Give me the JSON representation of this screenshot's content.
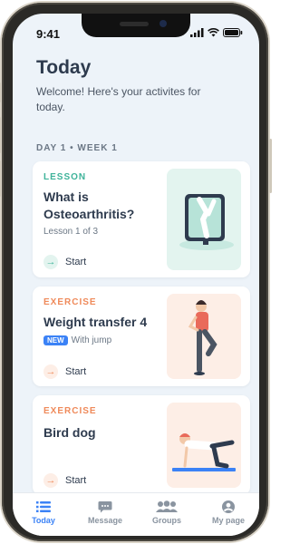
{
  "status_bar": {
    "time": "9:41"
  },
  "header": {
    "title": "Today",
    "subtitle": "Welcome! Here's your activites for today."
  },
  "section_label": "DAY 1 • WEEK 1",
  "cards": [
    {
      "kind": "LESSON",
      "kind_color": "#3fb39a",
      "title": "What is Osteoarthritis?",
      "meta": "Lesson 1 of 3",
      "start_label": "Start",
      "art_bg": "#e3f4ef",
      "art_icon": "knee-xray-illustration"
    },
    {
      "kind": "EXERCISE",
      "kind_color": "#ef8a5a",
      "title": "Weight transfer 4",
      "badge": "NEW",
      "meta": "With jump",
      "start_label": "Start",
      "art_bg": "#fdeee6",
      "art_icon": "woman-standing-exercise-illustration"
    },
    {
      "kind": "EXERCISE",
      "kind_color": "#ef8a5a",
      "title": "Bird dog",
      "start_label": "Start",
      "art_bg": "#fdeee6",
      "art_icon": "bird-dog-exercise-illustration"
    }
  ],
  "tabs": [
    {
      "label": "Today",
      "icon": "list-icon",
      "active": true
    },
    {
      "label": "Message",
      "icon": "chat-icon",
      "active": false
    },
    {
      "label": "Groups",
      "icon": "groups-icon",
      "active": false
    },
    {
      "label": "My page",
      "icon": "profile-icon",
      "active": false
    }
  ],
  "colors": {
    "accent": "#3b82f6",
    "lesson": "#3fb39a",
    "exercise": "#ef8a5a"
  }
}
